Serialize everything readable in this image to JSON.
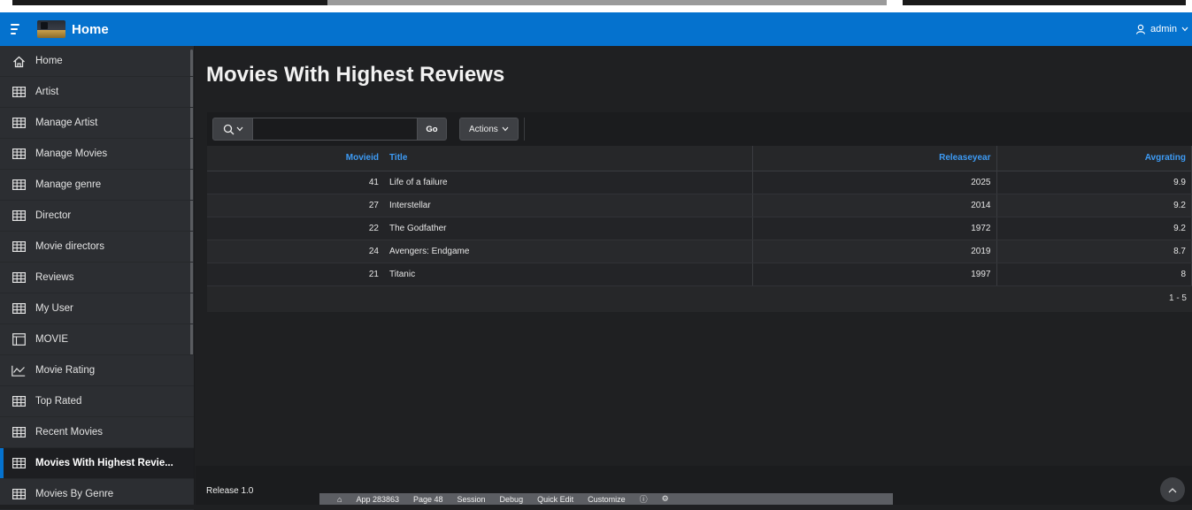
{
  "header": {
    "app_title": "Home",
    "user_name": "admin"
  },
  "sidebar": {
    "items": [
      {
        "label": "Home",
        "icon": "home-icon"
      },
      {
        "label": "Artist",
        "icon": "table-icon"
      },
      {
        "label": "Manage Artist",
        "icon": "table-icon"
      },
      {
        "label": "Manage Movies",
        "icon": "table-icon"
      },
      {
        "label": "Manage genre",
        "icon": "table-icon"
      },
      {
        "label": "Director",
        "icon": "table-icon"
      },
      {
        "label": "Movie directors",
        "icon": "table-icon"
      },
      {
        "label": "Reviews",
        "icon": "table-icon"
      },
      {
        "label": "My User",
        "icon": "table-icon"
      },
      {
        "label": "MOVIE",
        "icon": "layout-icon"
      },
      {
        "label": "Movie Rating",
        "icon": "chart-line-icon"
      },
      {
        "label": "Top Rated",
        "icon": "table-icon"
      },
      {
        "label": "Recent Movies",
        "icon": "table-icon"
      },
      {
        "label": "Movies With Highest Revie...",
        "icon": "table-icon",
        "active": true
      },
      {
        "label": "Movies By Genre",
        "icon": "table-icon"
      }
    ]
  },
  "main": {
    "page_title": "Movies With Highest Reviews",
    "toolbar": {
      "search_placeholder": "",
      "go_label": "Go",
      "actions_label": "Actions"
    },
    "table": {
      "columns": [
        "Movieid",
        "Title",
        "Releaseyear",
        "Avgrating"
      ],
      "rows": [
        [
          "41",
          "Life of a failure",
          "2025",
          "9.9"
        ],
        [
          "27",
          "Interstellar",
          "2014",
          "9.2"
        ],
        [
          "22",
          "The Godfather",
          "1972",
          "9.2"
        ],
        [
          "24",
          "Avengers: Endgame",
          "2019",
          "8.7"
        ],
        [
          "21",
          "Titanic",
          "1997",
          "8"
        ]
      ],
      "pagination": "1 - 5"
    }
  },
  "footer": {
    "release": "Release 1.0",
    "dev_toolbar": [
      "App 283863",
      "Page 48",
      "Session",
      "Debug",
      "Quick Edit",
      "Customize"
    ]
  },
  "colors": {
    "header_bg": "#0572ce",
    "accent": "#3d9bf5",
    "sidebar_bg": "#2c2e32",
    "body_bg": "#1f2022"
  }
}
